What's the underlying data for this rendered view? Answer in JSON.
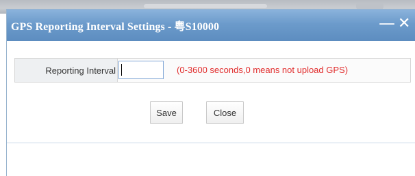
{
  "dialog": {
    "title": "GPS Reporting Interval Settings - 粤S10000",
    "minimize_glyph": "—",
    "close_glyph": "✕"
  },
  "form": {
    "interval_label": "Reporting Interval",
    "interval_value": "",
    "interval_hint": "(0-3600 seconds,0 means not upload GPS)"
  },
  "actions": {
    "save_label": "Save",
    "close_label": "Close"
  },
  "colors": {
    "titlebar": "#6c9bcb",
    "hint": "#e12d2d",
    "input_border": "#7fa6d6"
  },
  "icons": {
    "minimize": "minimize-icon",
    "close": "close-icon"
  }
}
